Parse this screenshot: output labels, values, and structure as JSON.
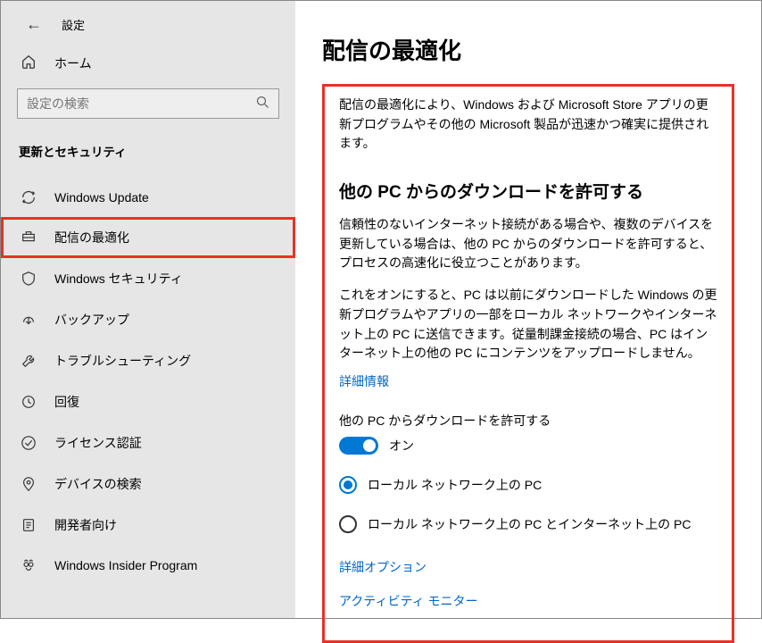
{
  "topbar": {
    "title": "設定"
  },
  "home": {
    "label": "ホーム"
  },
  "search": {
    "placeholder": "設定の検索"
  },
  "category": {
    "title": "更新とセキュリティ"
  },
  "nav": {
    "items": [
      {
        "label": "Windows Update"
      },
      {
        "label": "配信の最適化"
      },
      {
        "label": "Windows セキュリティ"
      },
      {
        "label": "バックアップ"
      },
      {
        "label": "トラブルシューティング"
      },
      {
        "label": "回復"
      },
      {
        "label": "ライセンス認証"
      },
      {
        "label": "デバイスの検索"
      },
      {
        "label": "開発者向け"
      },
      {
        "label": "Windows Insider Program"
      }
    ]
  },
  "main": {
    "page_title": "配信の最適化",
    "intro": "配信の最適化により、Windows および Microsoft Store アプリの更新プログラムやその他の Microsoft 製品が迅速かつ確実に提供されます。",
    "section_heading": "他の PC からのダウンロードを許可する",
    "para1": "信頼性のないインターネット接続がある場合や、複数のデバイスを更新している場合は、他の PC からのダウンロードを許可すると、プロセスの高速化に役立つことがあります。",
    "para2": "これをオンにすると、PC は以前にダウンロードした Windows の更新プログラムやアプリの一部をローカル ネットワークやインターネット上の PC に送信できます。従量制課金接続の場合、PC はインターネット上の他の PC にコンテンツをアップロードしません。",
    "details_link": "詳細情報",
    "toggle_label": "他の PC からダウンロードを許可する",
    "toggle_state": "オン",
    "radio1": "ローカル ネットワーク上の PC",
    "radio2": "ローカル ネットワーク上の PC とインターネット上の PC",
    "advanced_link": "詳細オプション",
    "activity_link": "アクティビティ モニター"
  }
}
